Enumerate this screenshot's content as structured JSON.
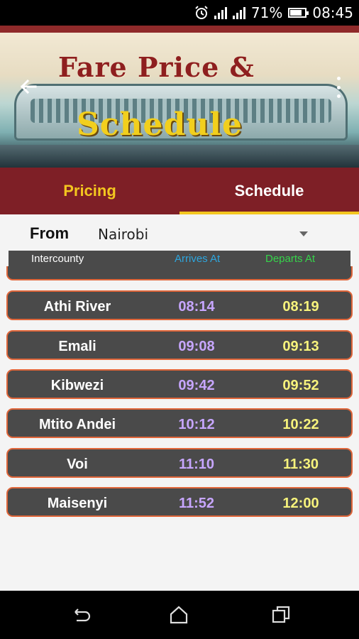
{
  "status_bar": {
    "alarm_icon": "alarm-icon",
    "battery_percent": "71%",
    "time": "08:45"
  },
  "app_bar": {
    "title_line1": "Fare Price &",
    "title_line2": "Schedule",
    "back_icon": "arrow-left-icon",
    "menu_icon": "more-vertical-icon"
  },
  "tabs": [
    {
      "label": "Pricing",
      "selected": false,
      "color": "#f3c61f"
    },
    {
      "label": "Schedule",
      "selected": true,
      "color": "#ffffff"
    }
  ],
  "from": {
    "label": "From",
    "value": "Nairobi"
  },
  "table_header": {
    "intercounty": "Intercounty",
    "arrives_at": "Arrives At",
    "departs_at": "Departs At"
  },
  "stops": [
    {
      "name": "Athi River",
      "arrives": "08:14",
      "departs": "08:19"
    },
    {
      "name": "Emali",
      "arrives": "09:08",
      "departs": "09:13"
    },
    {
      "name": "Kibwezi",
      "arrives": "09:42",
      "departs": "09:52"
    },
    {
      "name": "Mtito Andei",
      "arrives": "10:12",
      "departs": "10:22"
    },
    {
      "name": "Voi",
      "arrives": "11:10",
      "departs": "11:30"
    },
    {
      "name": "Maisenyi",
      "arrives": "11:52",
      "departs": "12:00"
    }
  ],
  "nav_bar": {
    "back_icon": "nav-back-icon",
    "home_icon": "nav-home-icon",
    "recents_icon": "nav-recents-icon"
  },
  "colors": {
    "tab_bar": "#7e1f26",
    "accent": "#f3c61f",
    "row_border": "#e0663a",
    "arrives": "#c7a6ff",
    "departs": "#f7f37c"
  }
}
